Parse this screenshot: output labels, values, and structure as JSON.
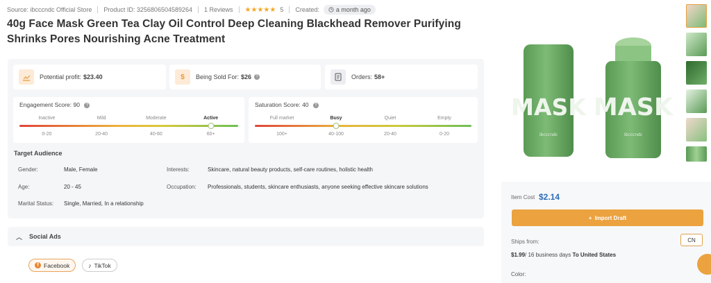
{
  "meta": {
    "source": "Source: ibcccndc Official Store",
    "product_id": "Product ID: 3256806504589264",
    "reviews": "1 Reviews",
    "stars": "★★★★★",
    "rating": "5",
    "created_label": "Created:",
    "created_value": "a month ago"
  },
  "title": "40g Face Mask Green Tea Clay Oil Control Deep Cleaning Blackhead Remover Purifying Shrinks Pores Nourishing Acne Treatment",
  "stats": {
    "profit_label": "Potential profit:",
    "profit_value": "$23.40",
    "sold_label": "Being Sold For:",
    "sold_value": "$26",
    "orders_label": "Orders:",
    "orders_value": "58+"
  },
  "engagement": {
    "label": "Engagement Score:",
    "value": "90",
    "levels": [
      "Inactive",
      "Mild",
      "Moderate",
      "Active"
    ],
    "ranges": [
      "0-20",
      "20-40",
      "40-60",
      "60+"
    ],
    "active_index": 3,
    "knob_fraction": 0.875
  },
  "saturation": {
    "label": "Saturation Score:",
    "value": "40",
    "levels": [
      "Full market",
      "Busy",
      "Quiet",
      "Empty"
    ],
    "ranges": [
      "100+",
      "40-100",
      "20-40",
      "0-20"
    ],
    "active_index": 1,
    "knob_fraction": 0.375
  },
  "audience": {
    "title": "Target Audience",
    "gender_label": "Gender:",
    "gender_value": "Male, Female",
    "age_label": "Age:",
    "age_value": "20 - 45",
    "marital_label": "Marital Status:",
    "marital_value": "Single, Married, In a relationship",
    "interests_label": "Interests:",
    "interests_value": "Skincare, natural beauty products, self-care routines, holistic health",
    "occupation_label": "Occupation:",
    "occupation_value": "Professionals, students, skincare enthusiasts, anyone seeking effective skincare solutions"
  },
  "social": {
    "title": "Social Ads",
    "facebook": "Facebook",
    "tiktok": "TikTok"
  },
  "product_image": {
    "label": "MASK",
    "brand": "ibcccndc"
  },
  "buy": {
    "cost_label": "Item Cost",
    "cost_value": "$2.14",
    "import_label": "Import Draft",
    "ships_from_label": "Ships from:",
    "country": "CN",
    "ship_price": "$1.99",
    "ship_days": "/ 16 business days",
    "ship_dest": "To United States",
    "color_label": "Color:"
  },
  "colors": {
    "accent": "#eba23f",
    "price_blue": "#2b6cb8",
    "mask_green": "#6fae6a"
  }
}
